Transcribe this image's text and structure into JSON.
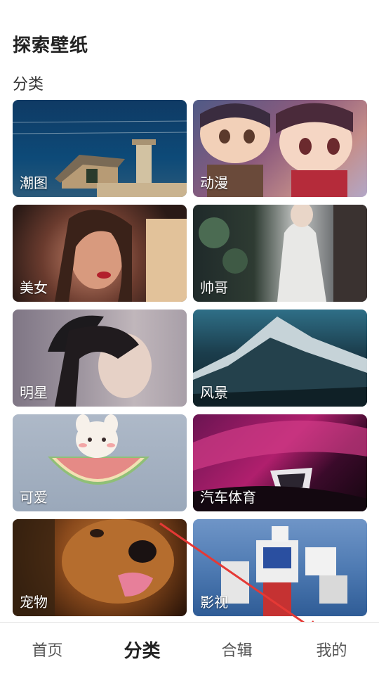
{
  "header": {
    "title": "探索壁纸",
    "section": "分类"
  },
  "categories": [
    {
      "label": "潮图",
      "art": "house-sky-photo"
    },
    {
      "label": "动漫",
      "art": "anime-characters"
    },
    {
      "label": "美女",
      "art": "woman-portrait"
    },
    {
      "label": "帅哥",
      "art": "man-white-robe"
    },
    {
      "label": "明星",
      "art": "celebrity-portrait"
    },
    {
      "label": "风景",
      "art": "snowy-mountain"
    },
    {
      "label": "可爱",
      "art": "bunny-watermelon"
    },
    {
      "label": "汽车体育",
      "art": "red-car-headlight"
    },
    {
      "label": "宠物",
      "art": "golden-retriever"
    },
    {
      "label": "影视",
      "art": "robot-statue"
    }
  ],
  "tabs": [
    {
      "label": "首页",
      "active": false
    },
    {
      "label": "分类",
      "active": true
    },
    {
      "label": "合辑",
      "active": false
    },
    {
      "label": "我的",
      "active": false
    }
  ],
  "colors": {
    "annotation_arrow": "#e53935",
    "text": "#222222",
    "tab_border": "#e0e0e0"
  }
}
